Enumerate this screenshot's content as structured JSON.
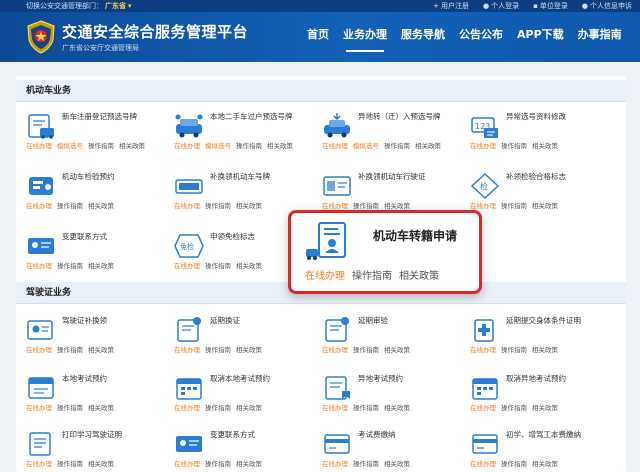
{
  "topbar": {
    "switch_label": "切换公安交通管理部门：",
    "province": "广东省",
    "links": [
      {
        "icon": "plus-icon",
        "label": "用户注册"
      },
      {
        "icon": "person-icon",
        "label": "个人登录"
      },
      {
        "icon": "building-icon",
        "label": "单位登录"
      },
      {
        "icon": "person-icon",
        "label": "个人信息申诉"
      }
    ]
  },
  "header": {
    "title": "交通安全综合服务管理平台",
    "subtitle": "广东省公安厅交通管理局",
    "nav": [
      "首页",
      "业务办理",
      "服务导航",
      "公告公布",
      "APP下载",
      "办事指南"
    ],
    "active_nav": "业务办理"
  },
  "colors": {
    "brand": "#1262b8",
    "accent": "#ff7a1a",
    "highlight": "#d8282b"
  },
  "sections": [
    {
      "title": "机动车业务"
    },
    {
      "title": "驾驶证业务"
    }
  ],
  "vehicle_services": [
    {
      "name": "新车注册登记预选号牌",
      "icon": "new-car-icon",
      "actions": [
        "在线办理",
        "模拟选号",
        "操作指南",
        "相关政策"
      ]
    },
    {
      "name": "本地二手车过户预选号牌",
      "icon": "transfer-car-icon",
      "actions": [
        "在线办理",
        "模拟选号",
        "操作指南",
        "相关政策"
      ]
    },
    {
      "name": "异地转（迁）入预选号牌",
      "icon": "relocate-car-icon",
      "actions": [
        "在线办理",
        "模拟选号",
        "操作指南",
        "相关政策"
      ]
    },
    {
      "name": "异常选号资料修改",
      "icon": "plate-edit-icon",
      "actions": [
        "在线办理",
        "操作指南",
        "相关政策"
      ]
    },
    {
      "name": "机动车检验预约",
      "icon": "inspection-icon",
      "actions": [
        "在线办理",
        "操作指南",
        "相关政策"
      ]
    },
    {
      "name": "补换领机动车号牌",
      "icon": "plate-icon",
      "actions": [
        "在线办理",
        "操作指南",
        "相关政策"
      ]
    },
    {
      "name": "补换领机动车行驶证",
      "icon": "license-card-icon",
      "actions": [
        "在线办理",
        "操作指南",
        "相关政策"
      ]
    },
    {
      "name": "补领检验合格标志",
      "icon": "inspection-badge-icon",
      "actions": [
        "在线办理",
        "操作指南",
        "相关政策"
      ]
    },
    {
      "name": "变更联系方式",
      "icon": "contact-card-icon",
      "actions": [
        "在线办理",
        "操作指南",
        "相关政策"
      ]
    },
    {
      "name": "申领免检标志",
      "icon": "exempt-badge-icon",
      "actions": [
        "在线办理",
        "操作指南",
        "相关政策"
      ]
    }
  ],
  "highlight": {
    "name": "机动车转籍申请",
    "icon": "vehicle-transfer-icon",
    "actions": [
      "在线办理",
      "操作指南",
      "相关政策"
    ]
  },
  "license_services": [
    {
      "name": "驾驶证补换领",
      "icon": "license-renew-icon",
      "actions": [
        "在线办理",
        "操作指南",
        "相关政策"
      ]
    },
    {
      "name": "延期换证",
      "icon": "delay-renew-icon",
      "actions": [
        "在线办理",
        "操作指南",
        "相关政策"
      ]
    },
    {
      "name": "延期审验",
      "icon": "delay-review-icon",
      "actions": [
        "在线办理",
        "操作指南",
        "相关政策"
      ]
    },
    {
      "name": "延期提交身体条件证明",
      "icon": "health-cert-icon",
      "actions": [
        "在线办理",
        "操作指南",
        "相关政策"
      ]
    },
    {
      "name": "本地考试预约",
      "icon": "exam-booking-icon",
      "actions": [
        "在线办理",
        "操作指南",
        "相关政策"
      ]
    },
    {
      "name": "取消本地考试预约",
      "icon": "cancel-booking-icon",
      "actions": [
        "在线办理",
        "操作指南",
        "相关政策"
      ]
    },
    {
      "name": "异地考试预约",
      "icon": "remote-exam-icon",
      "actions": [
        "在线办理",
        "操作指南",
        "相关政策"
      ]
    },
    {
      "name": "取消异地考试预约",
      "icon": "cancel-remote-icon",
      "actions": [
        "在线办理",
        "操作指南",
        "相关政策"
      ]
    },
    {
      "name": "打印学习驾驶证明",
      "icon": "print-cert-icon",
      "actions": [
        "在线办理",
        "操作指南",
        "相关政策"
      ]
    },
    {
      "name": "变更联系方式",
      "icon": "contact-change-icon",
      "actions": [
        "在线办理",
        "操作指南",
        "相关政策"
      ]
    },
    {
      "name": "考试费缴纳",
      "icon": "exam-fee-icon",
      "actions": [
        "在线办理",
        "操作指南",
        "相关政策"
      ]
    },
    {
      "name": "初学、增驾工本费缴纳",
      "icon": "fee-payment-icon",
      "actions": [
        "在线办理",
        "操作指南",
        "相关政策"
      ]
    }
  ]
}
